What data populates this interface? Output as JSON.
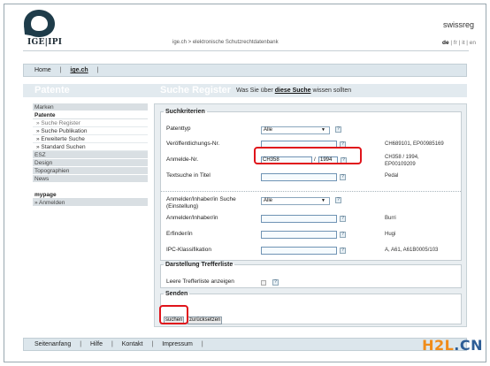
{
  "header": {
    "logo_text": "IGE|IPI",
    "site_id": "swissreg",
    "breadcrumb": "ige.ch > elektronische Schutzrechtdatenbank",
    "languages": [
      "de",
      "fr",
      "it",
      "en"
    ],
    "active_language": "de"
  },
  "nav": {
    "home": "Home",
    "ige": "ige.ch",
    "sep": "|"
  },
  "title": {
    "left": "Patente",
    "main": "Suche Register",
    "sub_prefix": "Was Sie über",
    "sub_link": "diese Suche",
    "sub_suffix": "wissen sollten"
  },
  "sidebar": {
    "items": [
      {
        "label": "Marken"
      },
      {
        "label": "Patente"
      },
      {
        "label": "» Suche Register"
      },
      {
        "label": "» Suche Publikation"
      },
      {
        "label": "» Erweiterte Suche"
      },
      {
        "label": "» Standard Suchen"
      },
      {
        "label": "ESZ"
      },
      {
        "label": "Design"
      },
      {
        "label": "Topographien"
      },
      {
        "label": "News"
      },
      {
        "label": "mypage"
      },
      {
        "label": "» Anmelden"
      }
    ]
  },
  "form": {
    "suchkriterien": "Suchkriterien",
    "patenttyp_label": "Patenttyp",
    "patenttyp_value": "Alle",
    "veroeff_label": "Veröffentlichungs-Nr.",
    "veroeff_value": "",
    "veroeff_example": "CH689101, EP00985169",
    "anmelde_label": "Anmelde-Nr.",
    "anmelde_value1": "CH358",
    "anmelde_sep": "/",
    "anmelde_value2": "1994",
    "anmelde_example_1": "CH358 / 1994,",
    "anmelde_example_2": "EP00109209",
    "titel_label": "Textsuche in Titel",
    "titel_value": "",
    "titel_example": "Pedal",
    "inhaber_suche_label_1": "Anmelder/Inhaber/in Suche",
    "inhaber_suche_label_2": "(Einstellung)",
    "inhaber_suche_value": "Alle",
    "inhaber_label": "Anmelder/Inhaber/in",
    "inhaber_value": "",
    "inhaber_example": "Burri",
    "erfinder_label": "Erfinder/in",
    "erfinder_value": "",
    "erfinder_example": "Hugi",
    "ipc_label": "IPC-Klassifikation",
    "ipc_value": "",
    "ipc_example": "A, A61, A61B0005/103",
    "darstellung": "Darstellung Trefferliste",
    "leere_label": "Leere Trefferliste anzeigen",
    "senden": "Senden",
    "suchen_button": "suchen",
    "zuruecksetzen_button": "zurücksetzen",
    "help_glyph": "?",
    "dropdown_glyph": "▼"
  },
  "footer": {
    "items": [
      "Seitenanfang",
      "Hilfe",
      "Kontakt",
      "Impressum"
    ],
    "sep": "|"
  },
  "watermark": {
    "part1": "H2L",
    "part2": ".CN"
  },
  "colors": {
    "highlight_red": "#e0141b",
    "watermark_orange": "#f08c1a",
    "watermark_dark": "#2d5d96"
  }
}
